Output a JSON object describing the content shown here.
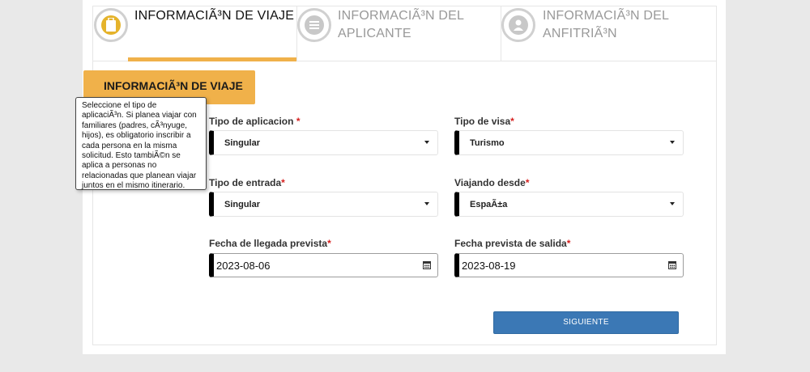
{
  "tabs": [
    {
      "label_line1": "INFORMACIÃ³N DE VIAJE",
      "label_line2": "",
      "icon": "suitcase-icon",
      "active": true
    },
    {
      "label_line1": "INFORMACIÃ³N DEL",
      "label_line2": "APLICANTE",
      "icon": "list-icon",
      "active": false
    },
    {
      "label_line1": "INFORMACIÃ³N DEL",
      "label_line2": "ANFITRIÃ³N",
      "icon": "user-icon",
      "active": false
    }
  ],
  "section_title": "INFORMACIÃ³N DE VIAJE",
  "tooltip": {
    "lines": [
      "Seleccione el tipo de",
      "aplicaciÃ³n. Si planea viajar con",
      "familiares (padres, cÃ³nyuge,",
      "hijos), es obligatorio inscribir a",
      "cada persona en la misma",
      "solicitud. Esto tambiÃ©n se",
      "aplica a personas no",
      "relacionadas que planean viajar",
      "juntos en el mismo itinerario."
    ]
  },
  "form": {
    "application_type": {
      "label": "Tipo de aplicacion ",
      "required": "*",
      "value": "Singular"
    },
    "visa_type": {
      "label": "Tipo de visa",
      "required": "*",
      "value": "Turismo"
    },
    "entry_type": {
      "label": "Tipo de entrada",
      "required": "*",
      "value": "Singular"
    },
    "traveling_from": {
      "label": "Viajando desde",
      "required": "*",
      "value": "EspaÃ±a"
    },
    "arrival_date": {
      "label": "Fecha de llegada prevista",
      "required": "*",
      "value": "2023-08-06"
    },
    "departure_date": {
      "label": "Fecha prevista de salida",
      "required": "*",
      "value": "2023-08-19"
    }
  },
  "next_button": "SIGUIENTE",
  "colors": {
    "accent": "#f0b14a",
    "button": "#3b78b5",
    "required": "#d6201f"
  }
}
